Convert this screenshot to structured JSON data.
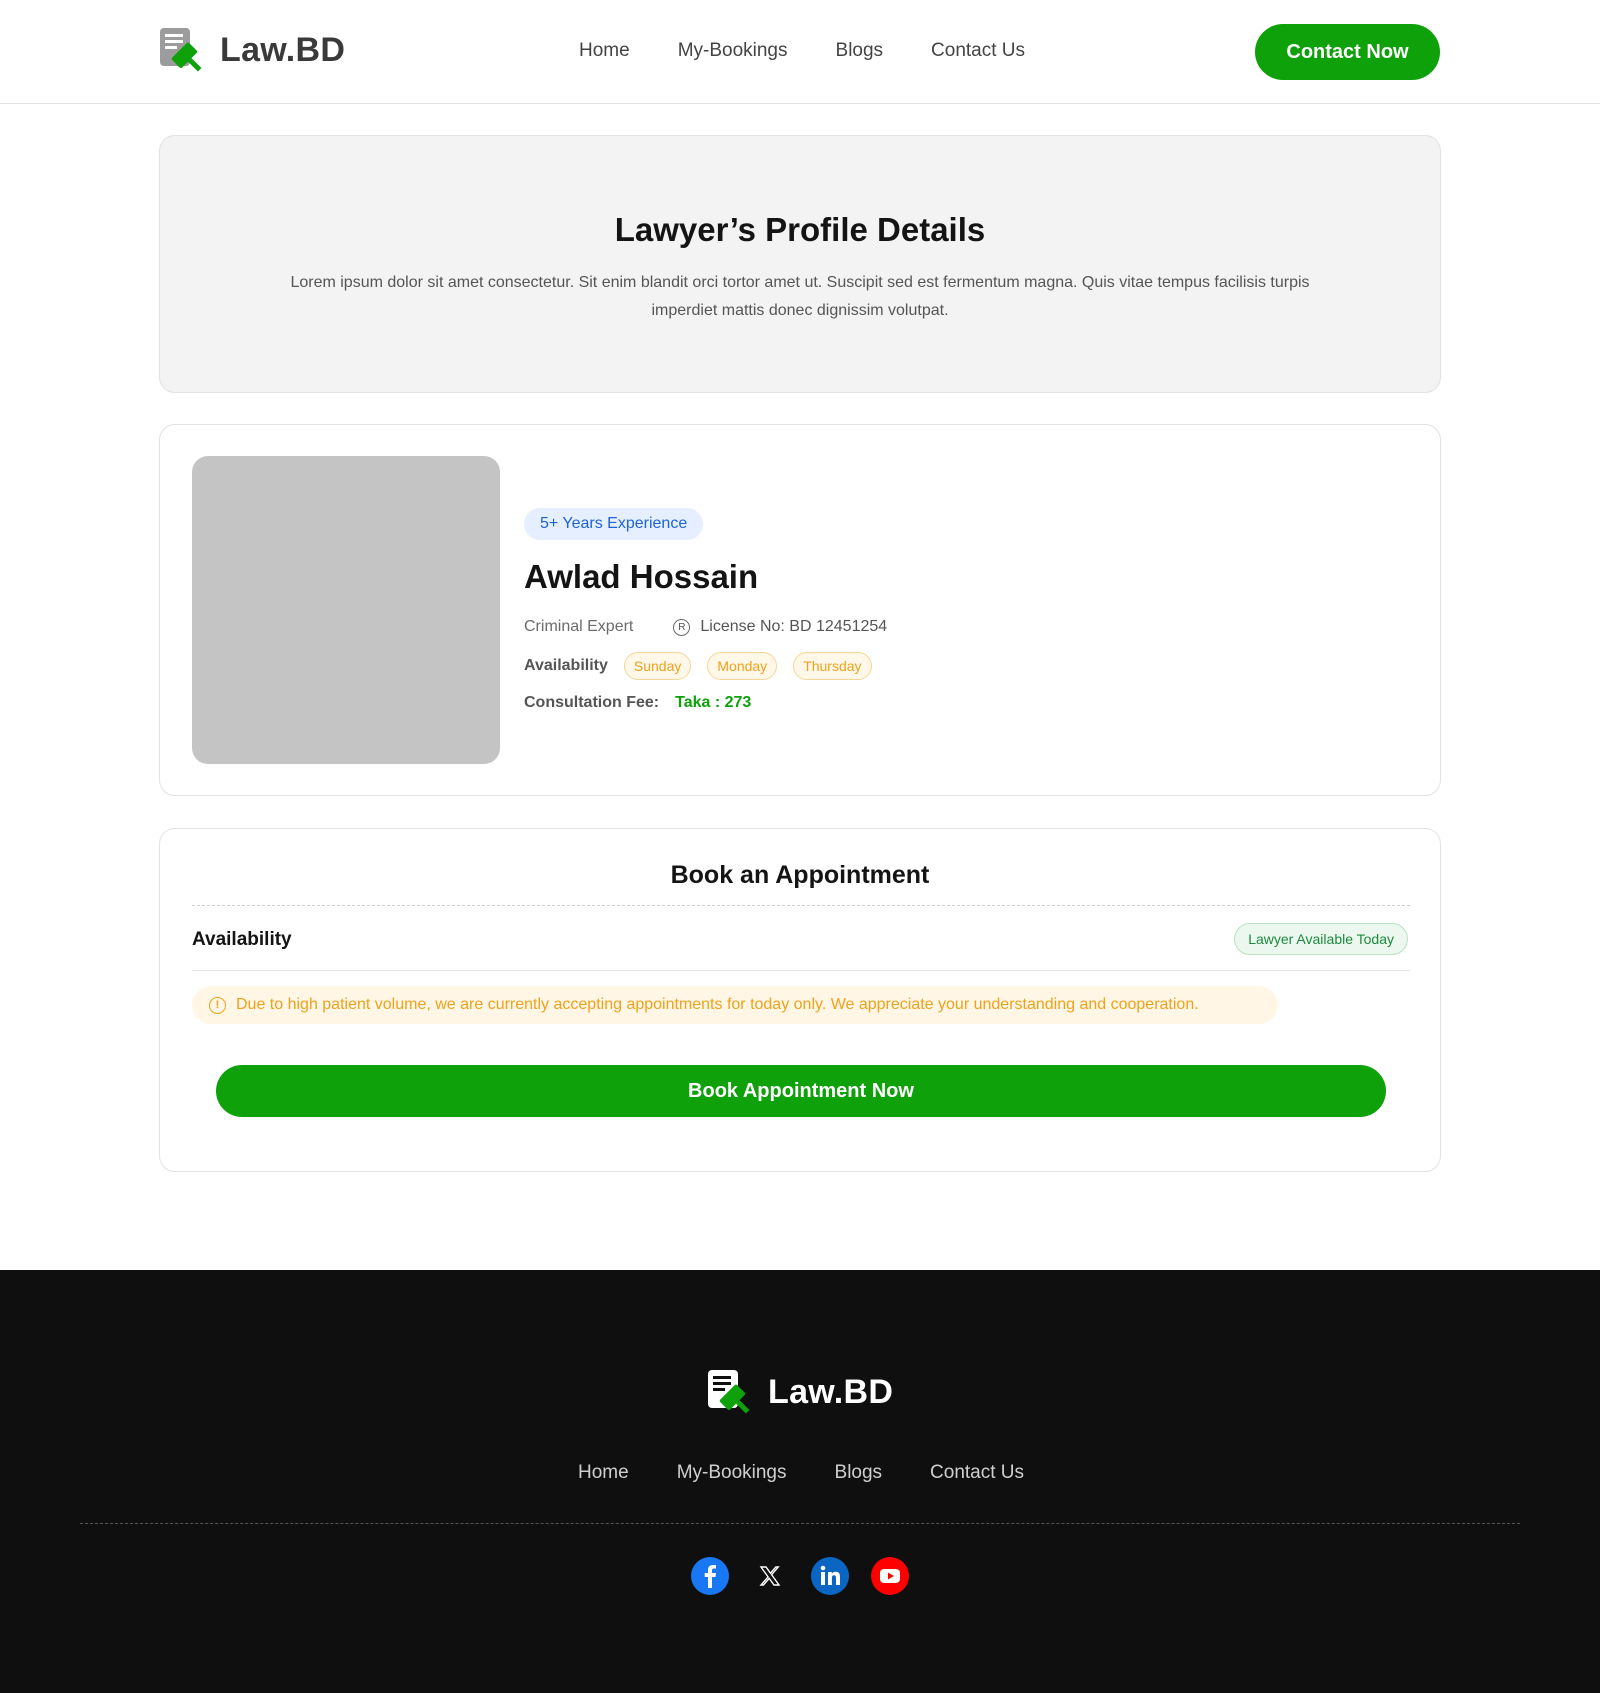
{
  "brand": {
    "name": "Law.BD",
    "primary_color": "#0ea10a"
  },
  "nav": {
    "items": [
      {
        "label": "Home"
      },
      {
        "label": "My-Bookings"
      },
      {
        "label": "Blogs"
      },
      {
        "label": "Contact Us"
      }
    ]
  },
  "header": {
    "cta_label": "Contact Now"
  },
  "hero": {
    "title": "Lawyer’s Profile Details",
    "description": "Lorem ipsum dolor sit amet consectetur. Sit enim blandit orci tortor amet ut. Suscipit sed est fermentum magna. Quis vitae tempus facilisis turpis imperdiet mattis donec dignissim volutpat."
  },
  "lawyer": {
    "experience": "5+ Years Experience",
    "name": "Awlad Hossain",
    "specialty": "Criminal Expert",
    "license": "License No: BD 12451254",
    "availability_label": "Availability",
    "days": [
      "Sunday",
      "Monday",
      "Thursday"
    ],
    "fee_label": "Consultation Fee:",
    "fee_value": "Taka : 273"
  },
  "appointment": {
    "title": "Book an Appointment",
    "availability_label": "Availability",
    "status_badge": "Lawyer Available Today",
    "notice": "Due to high patient volume, we are currently accepting appointments for today only. We appreciate your understanding and cooperation.",
    "button_label": "Book Appointment Now"
  },
  "footer": {
    "socials": [
      {
        "icon": "facebook-icon",
        "color": "#1877f2"
      },
      {
        "icon": "x-icon",
        "color": "#ffffff"
      },
      {
        "icon": "linkedin-icon",
        "color": "#0a66c2"
      },
      {
        "icon": "youtube-icon",
        "color": "#ff0000"
      }
    ]
  }
}
